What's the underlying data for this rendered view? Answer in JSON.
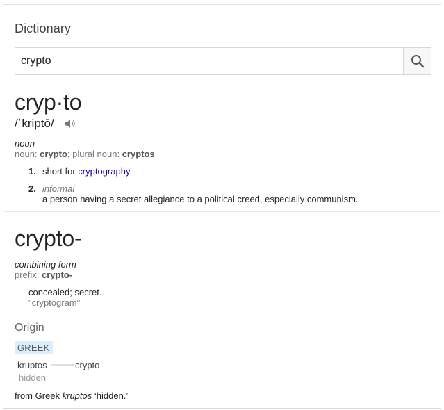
{
  "header": {
    "title": "Dictionary"
  },
  "search": {
    "value": "crypto",
    "icon": "search-icon"
  },
  "entry1": {
    "headword": "cryp·to",
    "pronunciation": "/ˈkriptō/",
    "audio_icon": "speaker-icon",
    "part_of_speech": "noun",
    "forms": {
      "noun_label": "noun: ",
      "noun_value": "crypto",
      "sep": "; ",
      "plural_label": "plural noun: ",
      "plural_value": "cryptos"
    },
    "senses": [
      {
        "num": "1.",
        "prefix": "short for ",
        "link": "cryptography",
        "suffix": "."
      },
      {
        "num": "2.",
        "label": "informal",
        "text": "a person having a secret allegiance to a political creed, especially communism."
      }
    ]
  },
  "entry2": {
    "headword": "crypto-",
    "part_of_speech": "combining form",
    "prefix_label": "prefix: ",
    "prefix_value": "crypto-",
    "definition": "concealed; secret.",
    "example": "\"cryptogram\""
  },
  "origin": {
    "title": "Origin",
    "language": "GREEK",
    "source_word": "kruptos",
    "source_gloss": "hidden",
    "target_word": "crypto-",
    "text_prefix": "from Greek ",
    "text_word": "kruptos",
    "text_suffix": " ‘hidden.’"
  },
  "colors": {
    "link": "#1a0dab",
    "badge_bg": "#dceefb",
    "muted": "#777777"
  }
}
